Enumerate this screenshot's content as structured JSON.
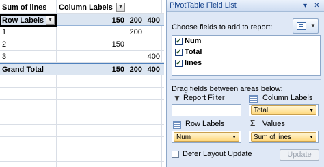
{
  "pivot": {
    "values_caption": "Sum of lines",
    "column_labels": "Column Labels",
    "row_labels": "Row Labels",
    "column_headers": [
      "150",
      "200",
      "400"
    ],
    "rows": [
      {
        "label": "1",
        "values": [
          "",
          "200",
          ""
        ]
      },
      {
        "label": "2",
        "values": [
          "150",
          "",
          ""
        ]
      },
      {
        "label": "3",
        "values": [
          "",
          "",
          "400"
        ]
      }
    ],
    "grand_total": {
      "label": "Grand Total",
      "values": [
        "150",
        "200",
        "400"
      ]
    }
  },
  "field_list": {
    "title": "PivotTable Field List",
    "choose_label": "Choose fields to add to report:",
    "fields": [
      {
        "name": "Num",
        "checked": true
      },
      {
        "name": "Total",
        "checked": true
      },
      {
        "name": "lines",
        "checked": true
      }
    ],
    "drag_label": "Drag fields between areas below:",
    "areas": {
      "report_filter": {
        "label": "Report Filter",
        "field": ""
      },
      "column_labels": {
        "label": "Column Labels",
        "field": "Total"
      },
      "row_labels": {
        "label": "Row Labels",
        "field": "Num"
      },
      "values": {
        "label": "Values",
        "field": "Sum of lines"
      }
    },
    "defer_label": "Defer Layout Update",
    "defer_checked": false,
    "update_label": "Update"
  },
  "icons": {
    "title_dropdown": "chevron-down-icon",
    "close": "close-icon",
    "filter": "filter-icon",
    "column_area": "column-labels-icon",
    "row_area": "row-labels-icon",
    "values_area": "sigma-icon"
  },
  "colors": {
    "header_fill": "#dbe5f1",
    "pane_background": "#dfe8f6",
    "field_button": "#ffd77a",
    "title_text": "#15428b"
  }
}
